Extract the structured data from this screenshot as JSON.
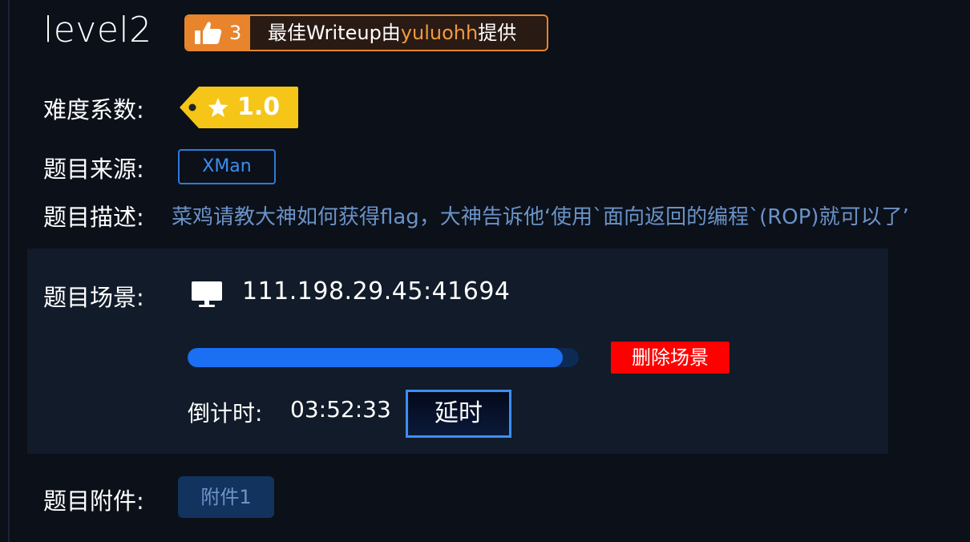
{
  "challenge": {
    "title": "level2",
    "likes": "3",
    "writeup_prefix": "最佳Writeup由",
    "writeup_user": "yuluohh",
    "writeup_suffix": "提供"
  },
  "difficulty": {
    "label": "难度系数:",
    "value": "1.0"
  },
  "source": {
    "label": "题目来源:",
    "value": "XMan"
  },
  "description": {
    "label": "题目描述:",
    "text": "菜鸡请教大神如何获得flag，大神告诉他‘使用`面向返回的编程`(ROP)就可以了’"
  },
  "scene": {
    "label": "题目场景:",
    "address": "111.198.29.45:41694",
    "progress_percent": 96,
    "delete_label": "删除场景",
    "countdown_label": "倒计时:",
    "countdown_value": "03:52:33",
    "delay_label": "延时"
  },
  "attachment": {
    "label": "题目附件:",
    "file_label": "附件1"
  },
  "colors": {
    "background": "#0b1019",
    "panel": "#111b29",
    "accent_orange": "#e8842c",
    "accent_blue": "#1a6ff2",
    "danger_red": "#ff0000",
    "tag_yellow": "#f5c518"
  },
  "icons": [
    "thumbs-up-icon",
    "star-icon",
    "monitor-icon"
  ]
}
